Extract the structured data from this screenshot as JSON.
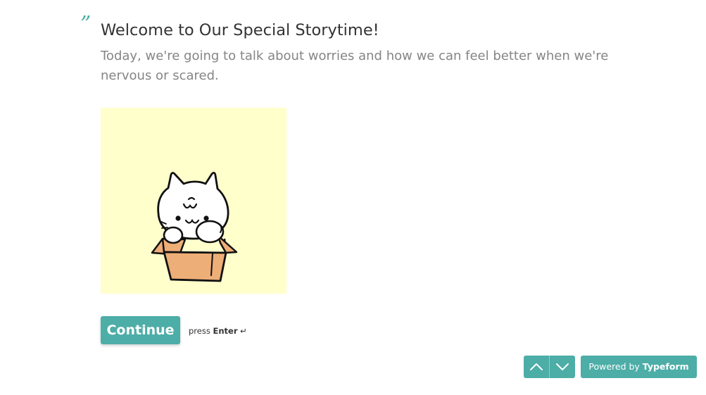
{
  "question": {
    "quote_mark": "”",
    "title": "Welcome to Our Special Storytime!",
    "description": "Today, we're going to talk about worries and how we can feel better when we're nervous or scared."
  },
  "media": {
    "icon": "cat-in-box-illustration",
    "background_color": "#ffffcc"
  },
  "actions": {
    "continue_label": "Continue",
    "hint_prefix": "press",
    "hint_key": "Enter",
    "hint_glyph": "↵"
  },
  "footer": {
    "prev_icon": "chevron-up-icon",
    "next_icon": "chevron-down-icon",
    "powered_prefix": "Powered by",
    "powered_brand": "Typeform"
  },
  "colors": {
    "accent": "#4dada7",
    "title_text": "#333333",
    "description_text": "#858585"
  }
}
